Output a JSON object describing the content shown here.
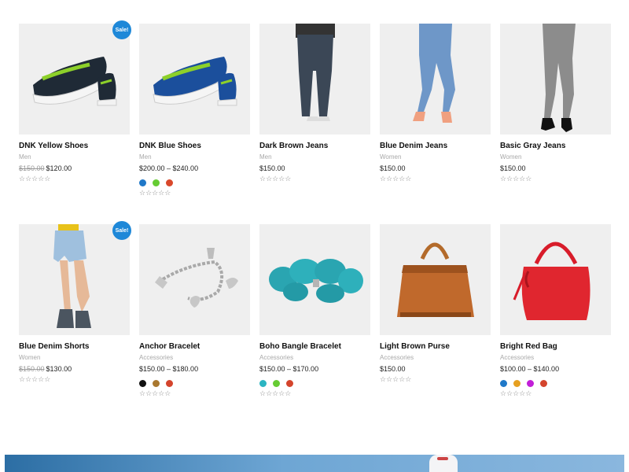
{
  "sale_badge": "Sale!",
  "products": [
    {
      "title": "DNK Yellow Shoes",
      "category": "Men",
      "old_price": "$150.00",
      "price": "$120.00",
      "sale": true,
      "swatches": [],
      "image": "sneaker-green"
    },
    {
      "title": "DNK Blue Shoes",
      "category": "Men",
      "old_price": "",
      "price": "$200.00 – $240.00",
      "sale": false,
      "swatches": [
        "#1f78c8",
        "#66cc33",
        "#d9482b"
      ],
      "image": "sneaker-blue"
    },
    {
      "title": "Dark Brown Jeans",
      "category": "Men",
      "old_price": "",
      "price": "$150.00",
      "sale": false,
      "swatches": [],
      "image": "jeans-dark"
    },
    {
      "title": "Blue Denim Jeans",
      "category": "Women",
      "old_price": "",
      "price": "$150.00",
      "sale": false,
      "swatches": [],
      "image": "jeans-blue"
    },
    {
      "title": "Basic Gray Jeans",
      "category": "Women",
      "old_price": "",
      "price": "$150.00",
      "sale": false,
      "swatches": [],
      "image": "jeans-gray"
    },
    {
      "title": "Blue Denim Shorts",
      "category": "Women",
      "old_price": "$150.00",
      "price": "$130.00",
      "sale": true,
      "swatches": [],
      "image": "shorts"
    },
    {
      "title": "Anchor Bracelet",
      "category": "Accessories",
      "old_price": "",
      "price": "$150.00 – $180.00",
      "sale": false,
      "swatches": [
        "#111111",
        "#a9782f",
        "#d4442c"
      ],
      "image": "bracelet-silver"
    },
    {
      "title": "Boho Bangle Bracelet",
      "category": "Accessories",
      "old_price": "",
      "price": "$150.00 – $170.00",
      "sale": false,
      "swatches": [
        "#2bb5c2",
        "#66cc33",
        "#d4442c"
      ],
      "image": "bracelet-turquoise"
    },
    {
      "title": "Light Brown Purse",
      "category": "Accessories",
      "old_price": "",
      "price": "$150.00",
      "sale": false,
      "swatches": [],
      "image": "purse-brown"
    },
    {
      "title": "Bright Red Bag",
      "category": "Accessories",
      "old_price": "",
      "price": "$100.00 – $140.00",
      "sale": false,
      "swatches": [
        "#1f78c8",
        "#e6a021",
        "#c21fd8",
        "#d4442c"
      ],
      "image": "bag-red"
    }
  ],
  "rating_stars": "☆☆☆☆☆"
}
